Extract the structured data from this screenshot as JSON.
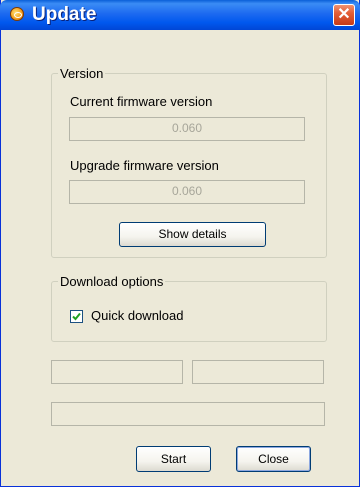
{
  "window": {
    "title": "Update",
    "close_symbol": "✕"
  },
  "version": {
    "legend": "Version",
    "current_label": "Current firmware version",
    "current_value": "0.060",
    "upgrade_label": "Upgrade firmware version",
    "upgrade_value": "0.060",
    "show_details_label": "Show details"
  },
  "download_options": {
    "legend": "Download options",
    "quick_download_label": "Quick download",
    "quick_download_checked": true
  },
  "status": {
    "left": "",
    "right": "",
    "progress": ""
  },
  "footer": {
    "start_label": "Start",
    "close_label": "Close"
  },
  "icons": {
    "title_icon": "update-icon",
    "close_icon": "close-icon",
    "check_icon": "check-icon"
  }
}
